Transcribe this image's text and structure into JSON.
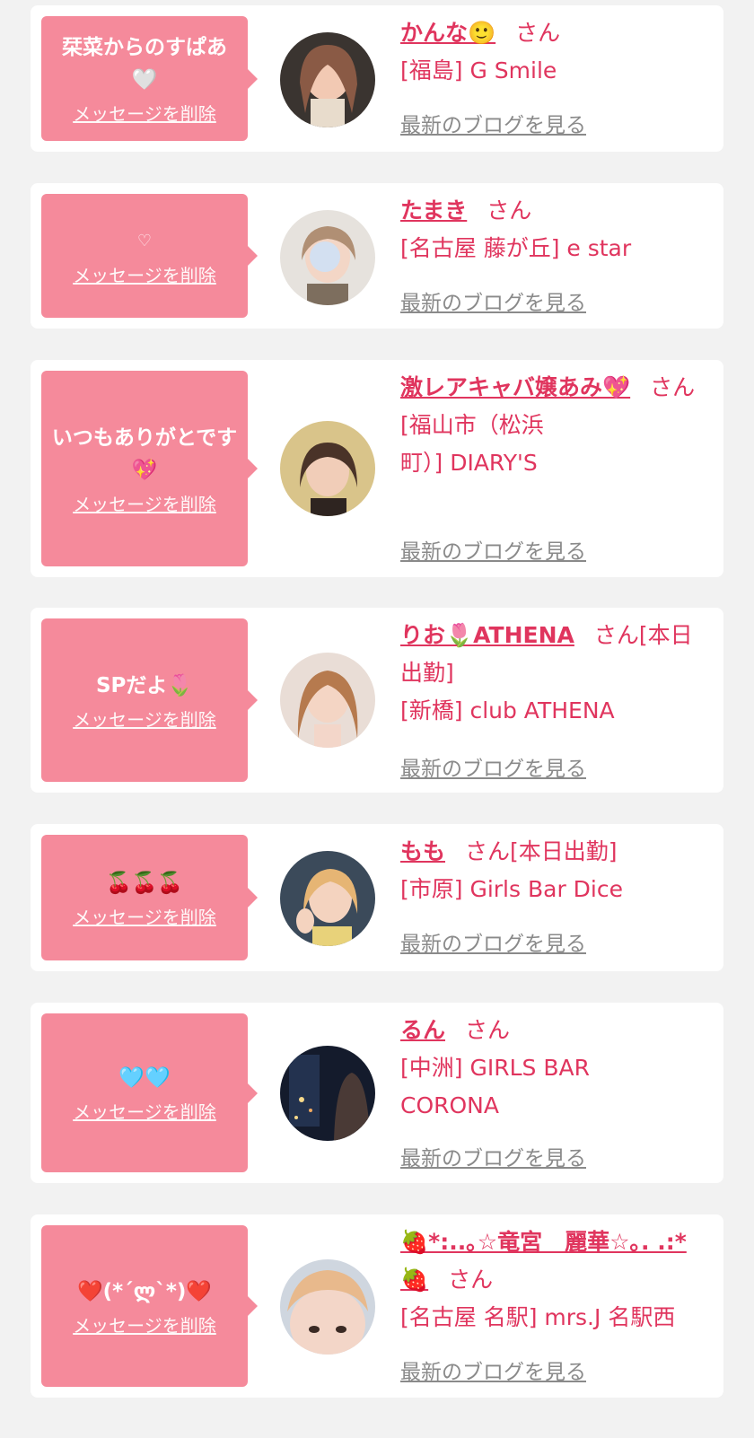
{
  "san_label": "さん",
  "delete_label": "メッセージを削除",
  "blog_label": "最新のブログを見る",
  "colors": {
    "accent": "#e0355e",
    "bubble": "#f58a9b",
    "background": "#f2f2f2",
    "card": "#ffffff"
  },
  "cards": [
    {
      "message": "栞菜からのすぱあ🤍",
      "name": "かんな🙂",
      "extra": "",
      "shop": "[福島] G Smile"
    },
    {
      "message": "♡",
      "name": "たまき",
      "extra": "",
      "shop": "[名古屋 藤が丘] e star"
    },
    {
      "message": "いつもありがとです💖",
      "name": "激レアキャバ嬢あみ💖",
      "extra": "",
      "shop": "[福山市（松浜町）] DIARY'S"
    },
    {
      "message": "SPだよ🌷",
      "name": "りお🌷ATHENA",
      "extra": "[本日出勤]",
      "shop": "[新橋] club ATHENA"
    },
    {
      "message": "🍒🍒🍒",
      "name": "もも",
      "extra": "[本日出勤]",
      "shop": "[市原] Girls Bar Dice"
    },
    {
      "message": "🩵🩵",
      "name": "るん",
      "extra": "",
      "shop": "[中洲] GIRLS BAR CORONA"
    },
    {
      "message": "❤️(*´ლ`*)❤️",
      "name": "🍓*:..｡☆竜宮　麗華☆｡. .:*🍓",
      "extra": "",
      "shop": "[名古屋 名駅] mrs.J 名駅西"
    }
  ]
}
